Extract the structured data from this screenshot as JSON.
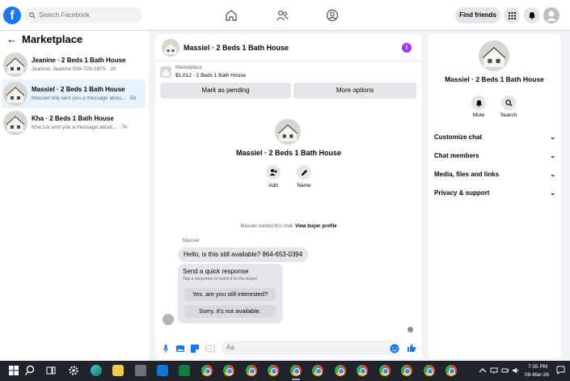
{
  "topbar": {
    "logo": "f",
    "search_placeholder": "Search Facebook",
    "find_friends": "Find friends"
  },
  "left": {
    "title": "Marketplace",
    "chats": [
      {
        "name": "Jeanine · 2 Beds 1 Bath House",
        "sub": "Jeanine: Jeanine 508-728-1875 · 2h"
      },
      {
        "name": "Massiel · 2 Beds 1 Bath House",
        "sub": "Massiel Vila sent you a message abou... · 5h"
      },
      {
        "name": "Kha · 2 Beds 1 Bath House",
        "sub": "Kha Lia sent you a message about... · 7h"
      }
    ]
  },
  "chat": {
    "title": "Massiel · 2 Beds 1 Bath House",
    "info": "i",
    "marketplace_label": "Marketplace",
    "listing": "$1,012 · 2 Beds 1 Bath House",
    "mark_pending": "Mark as pending",
    "more_options": "More options",
    "center_title": "Massiel · 2 Beds 1 Bath House",
    "add_label": "Add",
    "name_label": "Name",
    "started_prefix": "Massiel started this chat.",
    "view_profile": "View buyer profile",
    "sender": "Massiel",
    "message": "Hello, is this still available? 864-653-0394",
    "quick_title": "Send a quick response",
    "quick_sub": "Tap a response to send it to the buyer.",
    "quick_options": [
      "Yes, are you still interested?",
      "Sorry, it's not available."
    ],
    "composer_placeholder": "Aa"
  },
  "right": {
    "title": "Massiel · 2 Beds 1 Bath House",
    "mute_label": "Mute",
    "search_label": "Search",
    "rows": [
      "Customize chat",
      "Chat members",
      "Media, files and links",
      "Privacy & support"
    ]
  },
  "taskbar": {
    "time": "7:35 PM",
    "date": "08-Mar-26"
  },
  "colors": {
    "brand": "#1877f2",
    "accent_purple": "#a033ff",
    "active_chat_bg": "#e7f3ff"
  }
}
